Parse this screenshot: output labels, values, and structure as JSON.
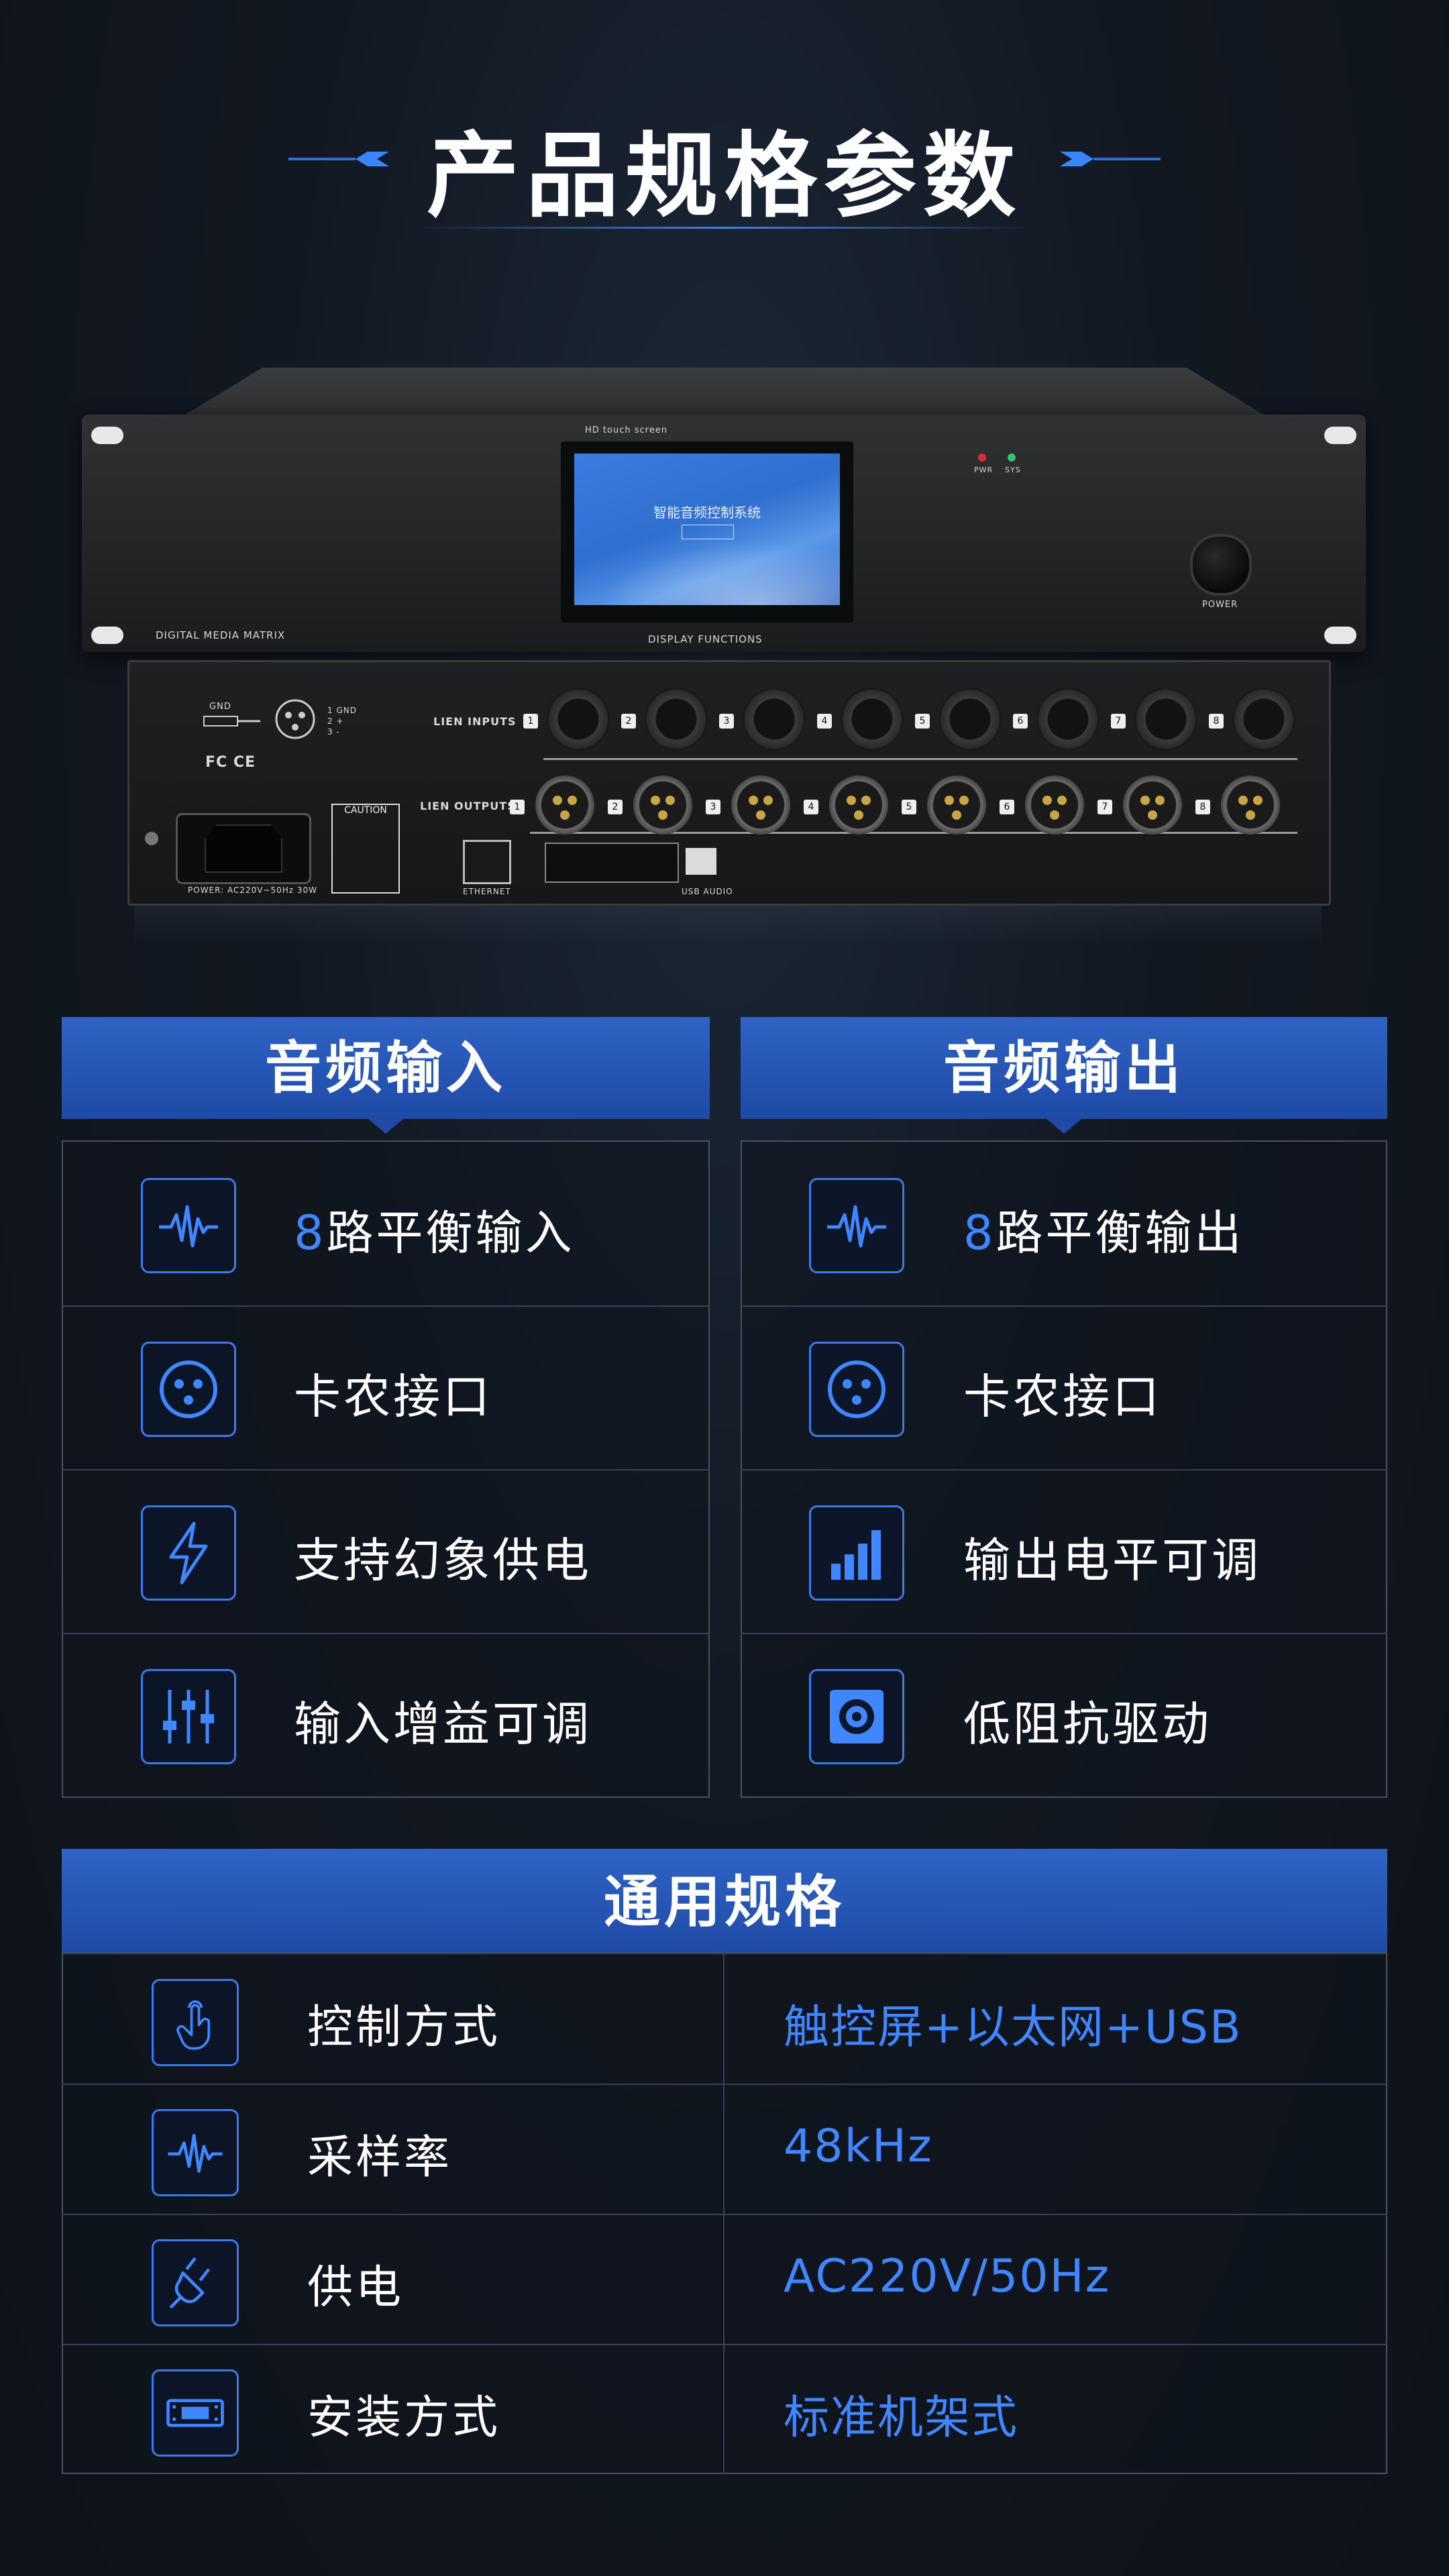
{
  "page_title": "产品规格参数",
  "device": {
    "front": {
      "screen_header": "HD touch screen",
      "screen_title": "智能音频控制系统",
      "brand_label": "DIGITAL MEDIA MATRIX",
      "display_label": "DISPLAY FUNCTIONS",
      "power_label": "POWER",
      "led_labels": [
        "PWR",
        "SYS"
      ]
    },
    "back": {
      "inputs_label": "LIEN INPUTS",
      "outputs_label": "LIEN OUTPUTS",
      "channels": [
        "1",
        "2",
        "3",
        "4",
        "5",
        "6",
        "7",
        "8"
      ],
      "gnd_label": "GND",
      "pin_labels": [
        "1 GND",
        "2 +",
        "3 -"
      ],
      "cert_marks": "FC CE",
      "caution_label": "CAUTION",
      "power_spec_label": "POWER: AC220V~50Hz 30W",
      "ethernet_label": "ETHERNET",
      "usb_label": "USB AUDIO"
    }
  },
  "audio_input": {
    "title": "音频输入",
    "items": [
      {
        "icon": "waveform-icon",
        "num": "8",
        "text": "路平衡输入"
      },
      {
        "icon": "xlr-connector-icon",
        "num": "",
        "text": "卡农接口"
      },
      {
        "icon": "lightning-icon",
        "num": "",
        "text": "支持幻象供电"
      },
      {
        "icon": "sliders-icon",
        "num": "",
        "text": "输入增益可调"
      }
    ]
  },
  "audio_output": {
    "title": "音频输出",
    "items": [
      {
        "icon": "waveform-icon",
        "num": "8",
        "text": "路平衡输出"
      },
      {
        "icon": "xlr-connector-icon",
        "num": "",
        "text": "卡农接口"
      },
      {
        "icon": "level-bars-icon",
        "num": "",
        "text": "输出电平可调"
      },
      {
        "icon": "speaker-icon",
        "num": "",
        "text": "低阻抗驱动"
      }
    ]
  },
  "general_specs": {
    "title": "通用规格",
    "rows": [
      {
        "icon": "touch-hand-icon",
        "label": "控制方式",
        "value": "触控屏+以太网+USB"
      },
      {
        "icon": "waveform-icon",
        "label": "采样率",
        "value": "48kHz"
      },
      {
        "icon": "plug-icon",
        "label": "供电",
        "value": "AC220V/50Hz"
      },
      {
        "icon": "rack-unit-icon",
        "label": "安装方式",
        "value": "标准机架式"
      }
    ]
  },
  "colors": {
    "accent": "#3f86ff",
    "header_blue": "#2f63c5",
    "background": "#121821"
  }
}
